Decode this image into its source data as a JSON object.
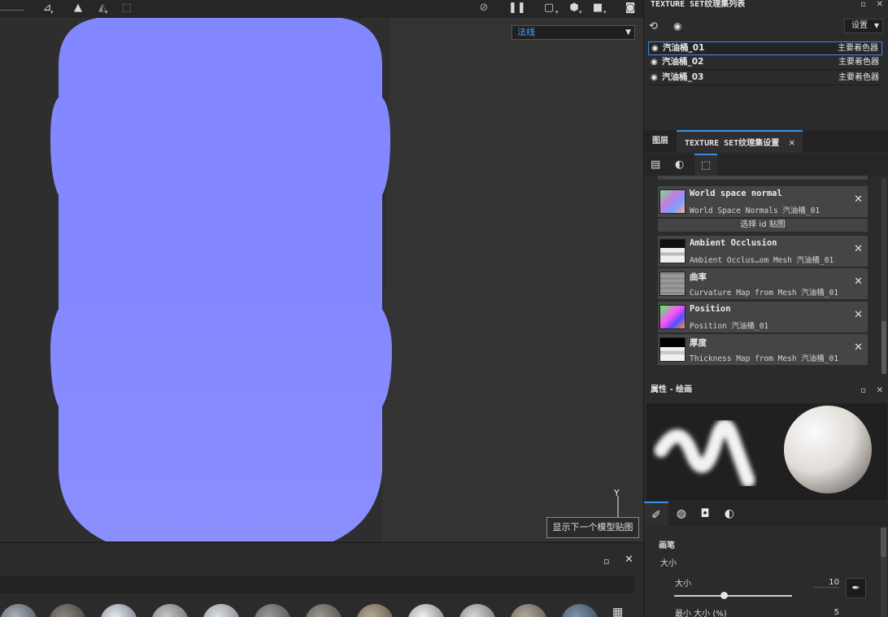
{
  "viewport": {
    "channel_select": "法线",
    "tooltip": "显示下一个模型贴图",
    "axis_label": "Y"
  },
  "texture_set_list": {
    "title": "TEXTURE SET纹理集列表",
    "settings_label": "设置",
    "items": [
      {
        "name": "汽油桶_01",
        "shader": "主要着色器"
      },
      {
        "name": "汽油桶_02",
        "shader": "主要着色器"
      },
      {
        "name": "汽油桶_03",
        "shader": "主要着色器"
      }
    ]
  },
  "texture_set_settings": {
    "tabs": [
      "图层",
      "TEXTURE SET纹理集设置"
    ],
    "select_id_label": "选择 id 贴图",
    "maps": [
      {
        "title": "World space normal",
        "sub": "World Space Normals 汽油桶_01",
        "thumb": "wsn"
      },
      {
        "title": "Ambient Occlusion",
        "sub": "Ambient Occlus…om Mesh 汽油桶_01",
        "thumb": "ao"
      },
      {
        "title": "曲率",
        "sub": "Curvature Map from Mesh 汽油桶_01",
        "thumb": "curv"
      },
      {
        "title": "Position",
        "sub": "Position 汽油桶_01",
        "thumb": "pos"
      },
      {
        "title": "厚度",
        "sub": "Thickness Map from Mesh 汽油桶_01",
        "thumb": "thick"
      }
    ]
  },
  "properties": {
    "title": "属性 - 绘画",
    "section": "画笔",
    "size_group": "大小",
    "size_label": "大小",
    "size_value": "10",
    "size_fraction": 0.42,
    "min_size_label": "最小 大小 (%)",
    "min_size_value": "5"
  },
  "colors": {
    "normal_blue": "#8387ff",
    "accent": "#3d8ce6"
  }
}
